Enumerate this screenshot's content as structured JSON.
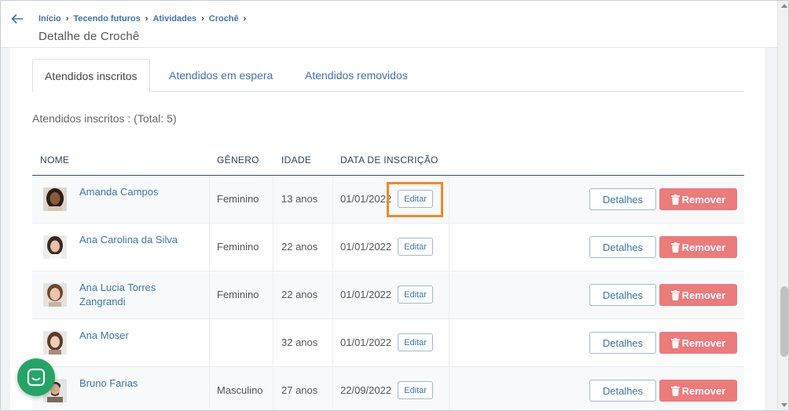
{
  "breadcrumb": {
    "items": [
      "Início",
      "Tecendo futuros",
      "Atividades",
      "Crochê"
    ]
  },
  "page_title": "Detalhe de Crochê",
  "tabs": [
    {
      "label": "Atendidos inscritos",
      "active": true
    },
    {
      "label": "Atendidos em espera",
      "active": false
    },
    {
      "label": "Atendidos removidos",
      "active": false
    }
  ],
  "summary": "Atendidos inscritos : (Total: 5)",
  "table": {
    "headers": {
      "name": "NOME",
      "gender": "GÊNERO",
      "age": "IDADE",
      "date": "DATA DE INSCRIÇÃO"
    },
    "edit_label": "Editar",
    "details_label": "Detalhes",
    "remove_label": "Remover",
    "rows": [
      {
        "name": "Amanda Campos",
        "gender": "Feminino",
        "age": "13 anos",
        "date": "01/01/2022"
      },
      {
        "name": "Ana Carolina da Silva",
        "gender": "Feminino",
        "age": "22 anos",
        "date": "01/01/2022"
      },
      {
        "name": "Ana Lucia Torres Zangrandi",
        "gender": "Feminino",
        "age": "22 anos",
        "date": "01/01/2022"
      },
      {
        "name": "Ana Moser",
        "gender": "",
        "age": "32 anos",
        "date": "01/01/2022"
      },
      {
        "name": "Bruno Farias",
        "gender": "Masculino",
        "age": "27 anos",
        "date": "22/09/2022"
      }
    ]
  },
  "colors": {
    "link": "#3f74a9",
    "remove": "#ec7b7b",
    "highlight": "#f08a2a",
    "chat": "#22a565"
  },
  "icons": [
    "back-arrow-icon",
    "chevron-right-icon",
    "trash-icon",
    "chat-icon"
  ]
}
